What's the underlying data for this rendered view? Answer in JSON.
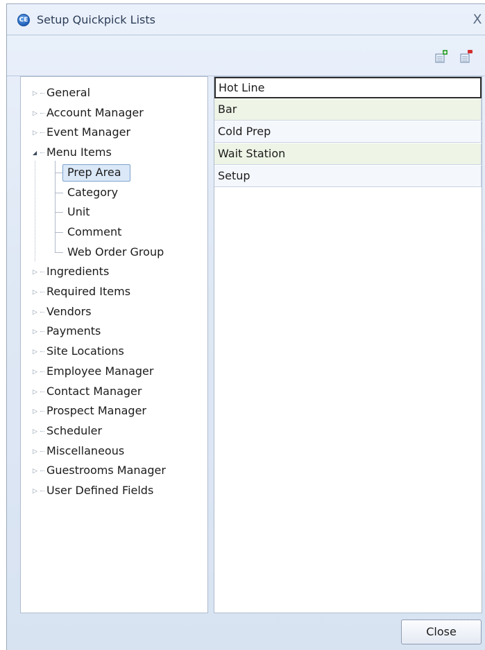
{
  "window": {
    "title": "Setup Quickpick Lists",
    "close_glyph": "X",
    "app_icon_text": "CE"
  },
  "toolbar": {
    "add_icon": "add-list-icon",
    "remove_icon": "remove-list-icon"
  },
  "tree": {
    "top_items": [
      {
        "label": "General",
        "expanded": false
      },
      {
        "label": "Account Manager",
        "expanded": false
      },
      {
        "label": "Event Manager",
        "expanded": false
      },
      {
        "label": "Menu Items",
        "expanded": true
      },
      {
        "label": "Ingredients",
        "expanded": false
      },
      {
        "label": "Required Items",
        "expanded": false
      },
      {
        "label": "Vendors",
        "expanded": false
      },
      {
        "label": "Payments",
        "expanded": false
      },
      {
        "label": "Site Locations",
        "expanded": false
      },
      {
        "label": "Employee Manager",
        "expanded": false
      },
      {
        "label": "Contact Manager",
        "expanded": false
      },
      {
        "label": "Prospect Manager",
        "expanded": false
      },
      {
        "label": "Scheduler",
        "expanded": false
      },
      {
        "label": "Miscellaneous",
        "expanded": false
      },
      {
        "label": "Guestrooms Manager",
        "expanded": false
      },
      {
        "label": "User Defined Fields",
        "expanded": false
      }
    ],
    "menu_items_children": [
      {
        "label": "Prep Area",
        "selected": true
      },
      {
        "label": "Category",
        "selected": false
      },
      {
        "label": "Unit",
        "selected": false
      },
      {
        "label": "Comment",
        "selected": false
      },
      {
        "label": "Web Order Group",
        "selected": false
      }
    ]
  },
  "list": {
    "rows": [
      {
        "label": "Hot Line",
        "selected": true
      },
      {
        "label": "Bar",
        "selected": false
      },
      {
        "label": "Cold Prep",
        "selected": false
      },
      {
        "label": "Wait Station",
        "selected": false
      },
      {
        "label": "Setup",
        "selected": false
      }
    ]
  },
  "footer": {
    "close_label": "Close"
  },
  "colors": {
    "accent": "#1f5fb8",
    "row_alt": "#eef5e6",
    "row_norm": "#f4f8fd",
    "selection": "#dbe8f8"
  }
}
